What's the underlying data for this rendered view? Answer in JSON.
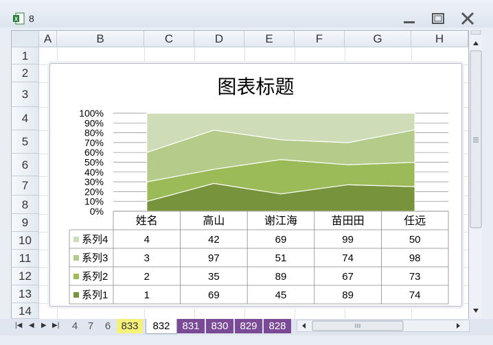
{
  "window": {
    "title": "8"
  },
  "columns": [
    "A",
    "B",
    "C",
    "D",
    "E",
    "F",
    "G",
    "H"
  ],
  "rows": [
    "1",
    "2",
    "3",
    "4",
    "5",
    "6",
    "7",
    "8",
    "9",
    "10",
    "11",
    "12",
    "13",
    "14"
  ],
  "chart": {
    "title": "图表标题"
  },
  "chart_data": {
    "type": "area",
    "stacking": "percent",
    "title": "图表标题",
    "categories": [
      "姓名",
      "高山",
      "谢江海",
      "苗田田",
      "任远"
    ],
    "series": [
      {
        "name": "系列1",
        "values": [
          1,
          69,
          45,
          89,
          74
        ],
        "color": "#77933c"
      },
      {
        "name": "系列2",
        "values": [
          2,
          35,
          89,
          67,
          73
        ],
        "color": "#9bbb59"
      },
      {
        "name": "系列3",
        "values": [
          3,
          97,
          51,
          74,
          98
        ],
        "color": "#b4cb8a"
      },
      {
        "name": "系列4",
        "values": [
          4,
          42,
          69,
          99,
          50
        ],
        "color": "#cfdcb8"
      }
    ],
    "yticks": [
      "0%",
      "10%",
      "20%",
      "30%",
      "40%",
      "50%",
      "60%",
      "70%",
      "80%",
      "90%",
      "100%"
    ],
    "ylim": [
      0,
      100
    ],
    "grid": true,
    "legend": "data-table"
  },
  "tabs": [
    "4",
    "7",
    "6",
    "833",
    "832",
    "831",
    "830",
    "829",
    "828"
  ],
  "active_tab": "832"
}
